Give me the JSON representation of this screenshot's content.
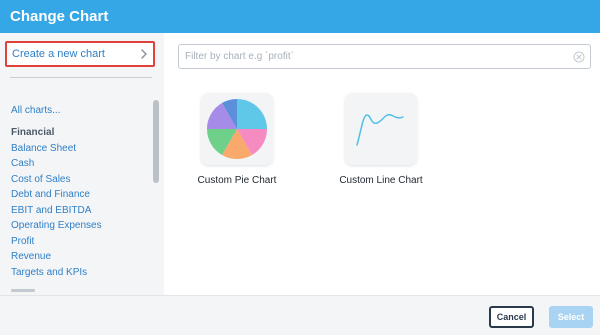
{
  "dialog": {
    "title": "Change Chart"
  },
  "sidebar": {
    "create_label": "Create a new chart",
    "categories": [
      {
        "label": "All charts..."
      },
      {
        "label": "Financial"
      },
      {
        "label": "Balance Sheet"
      },
      {
        "label": "Cash"
      },
      {
        "label": "Cost of Sales"
      },
      {
        "label": "Debt and Finance"
      },
      {
        "label": "EBIT and EBITDA"
      },
      {
        "label": "Operating Expenses"
      },
      {
        "label": "Profit"
      },
      {
        "label": "Revenue"
      },
      {
        "label": "Targets and KPIs"
      }
    ]
  },
  "filter": {
    "placeholder": "Filter by chart e.g `profit`",
    "value": ""
  },
  "charts": [
    {
      "label": "Custom Pie Chart",
      "icon": "pie-chart-icon"
    },
    {
      "label": "Custom Line Chart",
      "icon": "line-chart-icon"
    }
  ],
  "footer": {
    "cancel_label": "Cancel",
    "select_label": "Select"
  },
  "colors": {
    "header": "#35a6e6",
    "link": "#2f7fc6",
    "highlight_border": "#e0413a",
    "select_disabled": "#a9d3f2",
    "pie_slices": [
      "#5fc8e8",
      "#f58bc0",
      "#f9a96b",
      "#6fd08a",
      "#a78be8",
      "#5b8fd9"
    ],
    "line_stroke": "#4fc0e6"
  }
}
